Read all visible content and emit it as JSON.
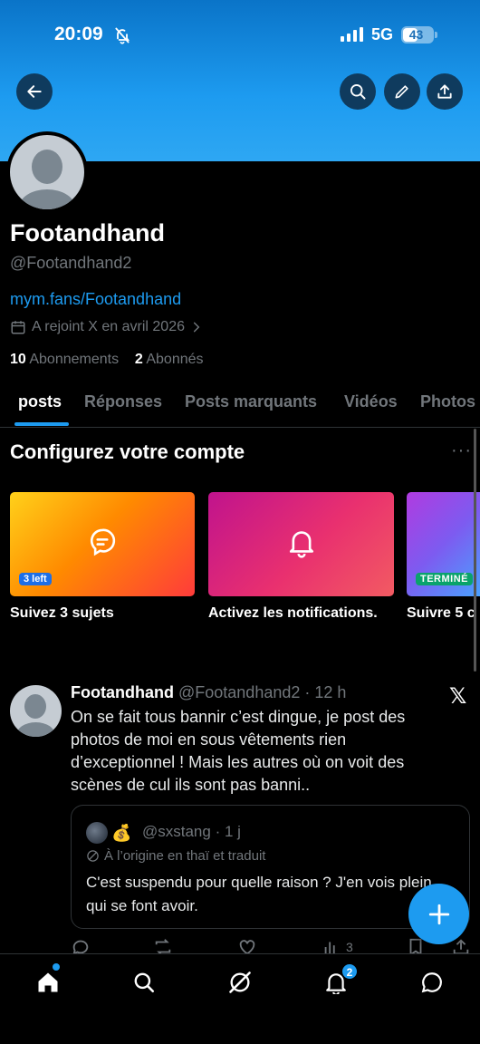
{
  "status_bar": {
    "time": "20:09",
    "network": "5G",
    "battery": "43"
  },
  "profile": {
    "name": "Footandhand",
    "handle": "@Footandhand2",
    "link": "mym.fans/Footandhand",
    "joined": "A rejoint X en avril 2026",
    "following_count": "10",
    "following_label": "Abonnements",
    "followers_count": "2",
    "followers_label": "Abonnés"
  },
  "tabs": [
    "posts",
    "Réponses",
    "Posts marquants",
    "Vidéos",
    "Photos"
  ],
  "setup": {
    "title": "Configurez votre compte",
    "more": "···",
    "cards": [
      {
        "label": "Suivez 3 sujets",
        "badge": "3 left",
        "icon": "topics-icon"
      },
      {
        "label": "Activez les notifications.",
        "badge": "",
        "icon": "bell-icon"
      },
      {
        "label": "Suivre 5 c",
        "badge": "TERMINÉ",
        "icon": ""
      }
    ]
  },
  "post": {
    "author": "Footandhand",
    "meta": "@Footandhand2 · 12 h",
    "text": "On se fait tous bannir c’est dingue, je post des photos de moi en sous vêtements rien d’exceptionnel ! Mais les autres où on voit des scènes de cul ils sont pas banni..",
    "quote": {
      "emoji": "💰",
      "meta": "@sxstang · 1 j",
      "translated": "À l’origine en thaï et traduit",
      "text": "C'est suspendu pour quelle raison ? J'en vois plein qui se font avoir."
    },
    "views": "3"
  },
  "nav": {
    "notifications_badge": "2"
  },
  "colors": {
    "accent": "#1d9bf0",
    "background": "#000000",
    "muted": "#71767b"
  }
}
